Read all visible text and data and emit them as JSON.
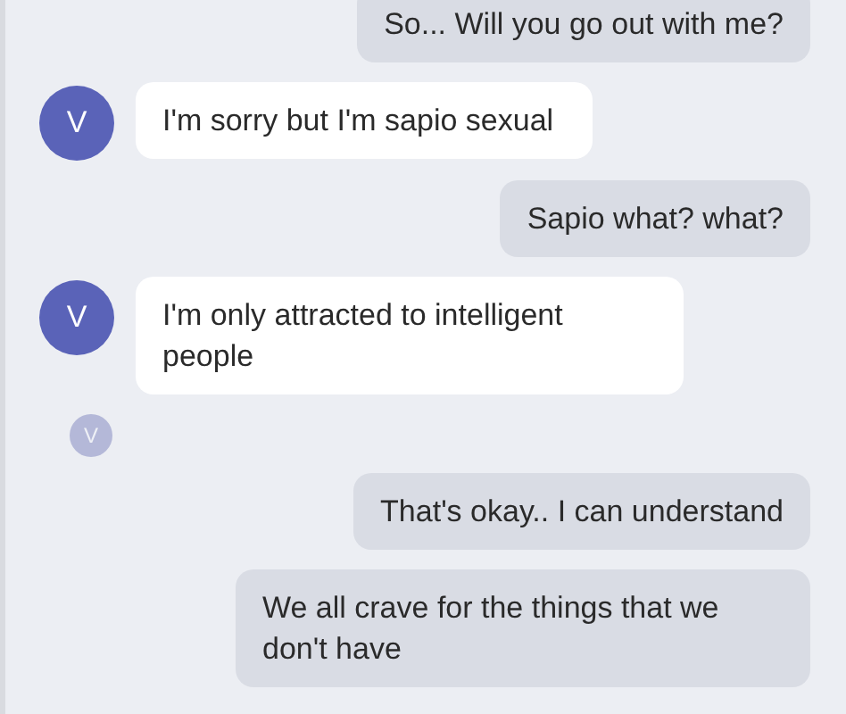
{
  "messages": [
    {
      "kind": "sent",
      "text": "So... Will you go out with me?"
    },
    {
      "kind": "received",
      "avatar": "V",
      "text": "I'm sorry but I'm sapio sexual"
    },
    {
      "kind": "sent",
      "text": "Sapio what? what?"
    },
    {
      "kind": "received",
      "avatar": "V",
      "text": "I'm only attracted to intelligent people"
    },
    {
      "kind": "read_receipt",
      "avatar": "V"
    },
    {
      "kind": "sent",
      "text": "That's okay.. I can understand"
    },
    {
      "kind": "sent",
      "text": "We all crave for the things that we don't have"
    }
  ]
}
